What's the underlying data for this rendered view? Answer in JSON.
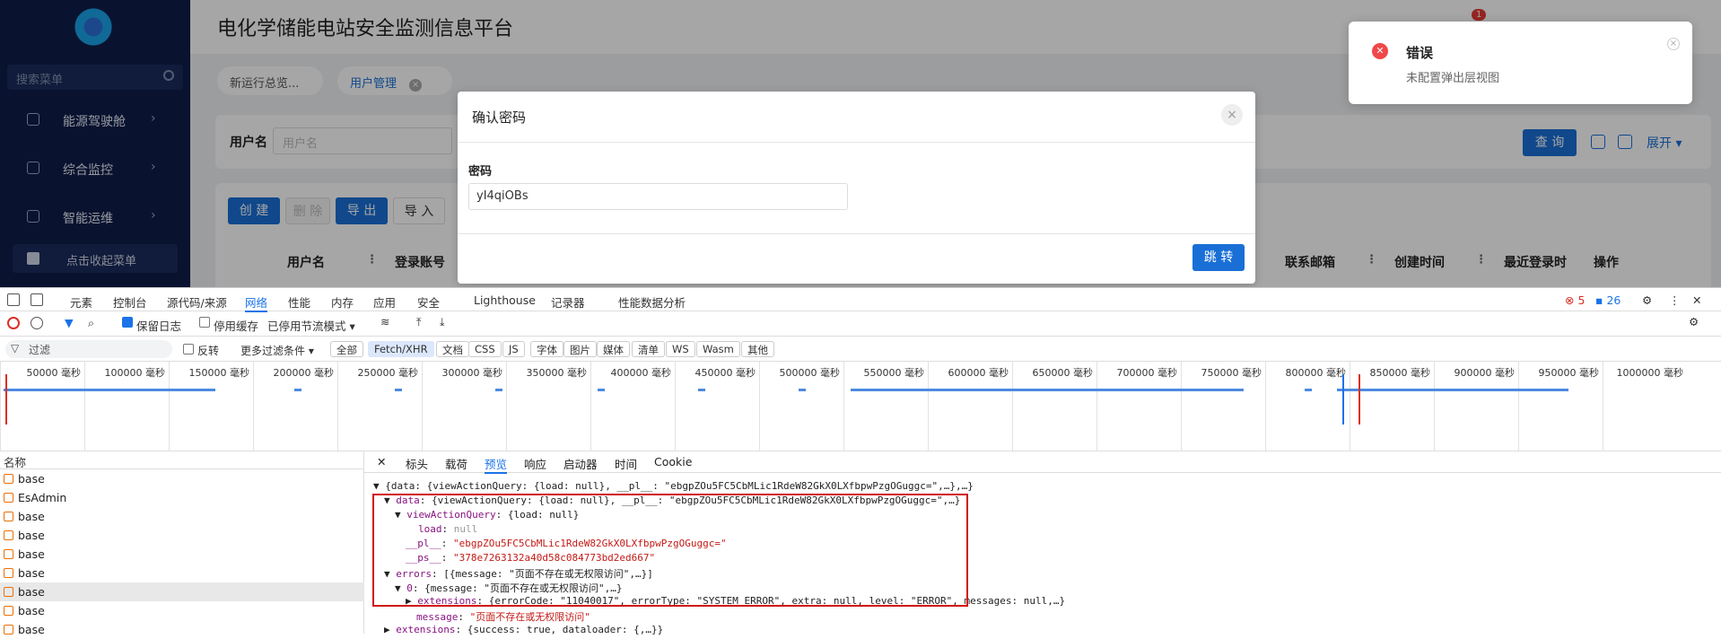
{
  "sidebar": {
    "search_placeholder": "搜索菜单",
    "items": [
      {
        "label": "能源驾驶舱"
      },
      {
        "label": "综合监控"
      },
      {
        "label": "智能运维"
      }
    ],
    "collapse_label": "点击收起菜单"
  },
  "header": {
    "title": "电化学储能电站安全监测信息平台",
    "notification_count": "1"
  },
  "tabs": [
    {
      "label": "新运行总览..."
    },
    {
      "label": "用户管理"
    }
  ],
  "filter": {
    "username_label": "用户名",
    "username_placeholder": "用户名",
    "query_label": "查 询",
    "expand_label": "展开"
  },
  "toolbar": {
    "create": "创 建",
    "delete": "删 除",
    "export": "导 出",
    "import": "导 入"
  },
  "table_headers": [
    "用户名",
    "登录账号",
    "联系邮箱",
    "创建时间",
    "最近登录时",
    "操作"
  ],
  "modal": {
    "title": "确认密码",
    "password_label": "密码",
    "password_value": "yI4qiOBs",
    "submit_label": "跳 转"
  },
  "toast": {
    "title": "错误",
    "message": "未配置弹出层视图"
  },
  "devtools": {
    "tabs": [
      "元素",
      "控制台",
      "源代码/来源",
      "网络",
      "性能",
      "内存",
      "应用",
      "安全",
      "Lighthouse",
      "记录器",
      "性能数据分析"
    ],
    "active_tab": "网络",
    "error_count": "5",
    "message_count": "26",
    "preserve_log": "保留日志",
    "disable_cache": "停用缓存",
    "throttle": "已停用节流模式",
    "filter_placeholder": "过滤",
    "invert": "反转",
    "more_filters": "更多过滤条件",
    "type_filters": [
      "全部",
      "Fetch/XHR",
      "文档",
      "CSS",
      "JS",
      "字体",
      "图片",
      "媒体",
      "清单",
      "WS",
      "Wasm",
      "其他"
    ],
    "active_type": "Fetch/XHR",
    "timeline_ticks": [
      "50000 毫秒",
      "100000 毫秒",
      "150000 毫秒",
      "200000 毫秒",
      "250000 毫秒",
      "300000 毫秒",
      "350000 毫秒",
      "400000 毫秒",
      "450000 毫秒",
      "500000 毫秒",
      "550000 毫秒",
      "600000 毫秒",
      "650000 毫秒",
      "700000 毫秒",
      "750000 毫秒",
      "800000 毫秒",
      "850000 毫秒",
      "900000 毫秒",
      "950000 毫秒",
      "1000000 毫秒"
    ],
    "list_header": "名称",
    "requests": [
      "base",
      "EsAdmin",
      "base",
      "base",
      "base",
      "base",
      "base",
      "base",
      "base"
    ],
    "detail_tabs": [
      "标头",
      "载荷",
      "预览",
      "响应",
      "启动器",
      "时间",
      "Cookie"
    ],
    "active_detail_tab": "预览",
    "preview": {
      "l1": "{data: {viewActionQuery: {load: null}, __pl__: \"ebgpZOu5FC5CbMLic1RdeW82GkX0LXfbpwPzgOGuggc=\",…},…}",
      "l2_key": "data",
      "l2_val": "{viewActionQuery: {load: null}, __pl__: \"ebgpZOu5FC5CbMLic1RdeW82GkX0LXfbpwPzgOGuggc=\",…}",
      "l3_key": "viewActionQuery",
      "l3_val": "{load: null}",
      "l4_key": "load",
      "l4_val": "null",
      "l5_key": "__pl__",
      "l5_val": "\"ebgpZOu5FC5CbMLic1RdeW82GkX0LXfbpwPzgOGuggc=\"",
      "l6_key": "__ps__",
      "l6_val": "\"378e7263132a40d58c084773bd2ed667\"",
      "l7_key": "errors",
      "l7_val": "[{message: \"页面不存在或无权限访问\",…}]",
      "l8_key": "0",
      "l8_val": "{message: \"页面不存在或无权限访问\",…}",
      "l9_key": "extensions",
      "l9_val": "{errorCode: \"11040017\", errorType: \"SYSTEM_ERROR\", extra: null, level: \"ERROR\", messages: null,…}",
      "l10_key": "message",
      "l10_val": "\"页面不存在或无权限访问\"",
      "l11_key": "extensions",
      "l11_val": "{success: true, dataloader: {,…}}"
    }
  }
}
